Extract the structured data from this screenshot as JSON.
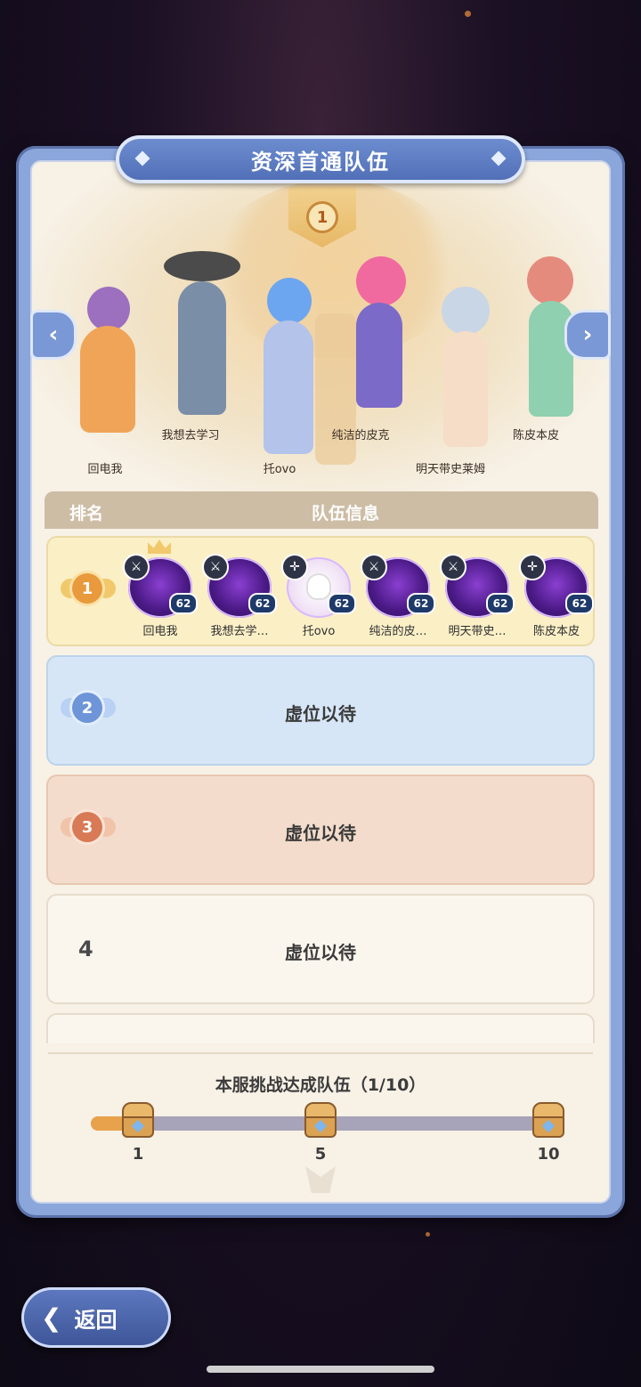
{
  "title": "资深首通队伍",
  "table": {
    "rank_header": "排名",
    "info_header": "队伍信息"
  },
  "showcase": {
    "rank": "1",
    "characters": [
      "回电我",
      "我想去学习",
      "托ovo",
      "纯洁的皮克",
      "明天带史莱姆",
      "陈皮本皮"
    ]
  },
  "rows": [
    {
      "rank": "1",
      "members": [
        {
          "name": "回电我",
          "level": "62",
          "class_icon": "sword-icon",
          "captain": true
        },
        {
          "name": "我想去学…",
          "level": "62",
          "class_icon": "sword-icon"
        },
        {
          "name": "托ovo",
          "level": "62",
          "class_icon": "cross-icon"
        },
        {
          "name": "纯洁的皮…",
          "level": "62",
          "class_icon": "sword-icon"
        },
        {
          "name": "明天带史…",
          "level": "62",
          "class_icon": "sword-icon"
        },
        {
          "name": "陈皮本皮",
          "level": "62",
          "class_icon": "cross-icon"
        }
      ]
    },
    {
      "rank": "2",
      "text": "虚位以待"
    },
    {
      "rank": "3",
      "text": "虚位以待"
    },
    {
      "rank": "4",
      "text": "虚位以待"
    }
  ],
  "progress": {
    "title": "本服挑战达成队伍（1/10）",
    "current": 1,
    "total": 10,
    "milestones": [
      "1",
      "5",
      "10"
    ]
  },
  "back_button": {
    "label": "返回"
  },
  "colors": {
    "accent": "#6f8fd2",
    "gold": "#e7a24b",
    "panel_bg": "#f7f1e6"
  }
}
